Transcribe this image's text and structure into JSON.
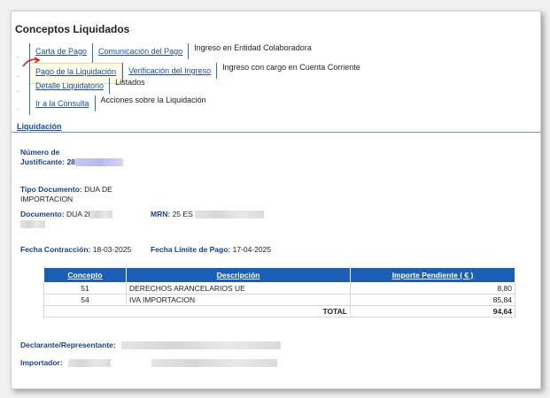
{
  "page_title": "Conceptos Liquidados",
  "tabs": {
    "row1": [
      "Carta de Pago",
      "Comunicación del Pago",
      "Ingreso en Entidad Colaboradora"
    ],
    "row2": [
      "Pago de la Liquidación",
      "Verificación del Ingreso",
      "Ingreso con cargo en Cuenta Corriente"
    ],
    "row3": [
      "Detalle Liquidatorio",
      "Listados"
    ],
    "row4": [
      "Ir a la Consulta",
      "Acciones sobre la Liquidación"
    ]
  },
  "section": "Liquidación",
  "fields": {
    "numero_label_1": "Número de",
    "numero_label_2": "Justificante:",
    "numero_value": "28",
    "tipo_label": "Tipo Documento:",
    "tipo_value_1": "DUA DE",
    "tipo_value_2": "IMPORTACION",
    "documento_label": "Documento:",
    "documento_value": "DUA 2l",
    "mrn_label": "MRN:",
    "mrn_value": "25 ES",
    "fecha_contr_label": "Fecha Contracción:",
    "fecha_contr_value": "18-03-2025",
    "fecha_lim_label": "Fecha Límite de Pago:",
    "fecha_lim_value": "17-04-2025",
    "declarante_label": "Declarante/Representante:",
    "importador_label": "Importador:"
  },
  "table": {
    "headers": [
      "Concepto",
      "Descripción",
      "Importe Pendiente ( € )"
    ],
    "rows": [
      {
        "concepto": "51",
        "descripcion": "DERECHOS ARANCELARIOS UE",
        "importe": "8,80"
      },
      {
        "concepto": "54",
        "descripcion": "IVA IMPORTACION",
        "importe": "85,84"
      }
    ],
    "total_label": "TOTAL",
    "total_value": "94,64"
  }
}
